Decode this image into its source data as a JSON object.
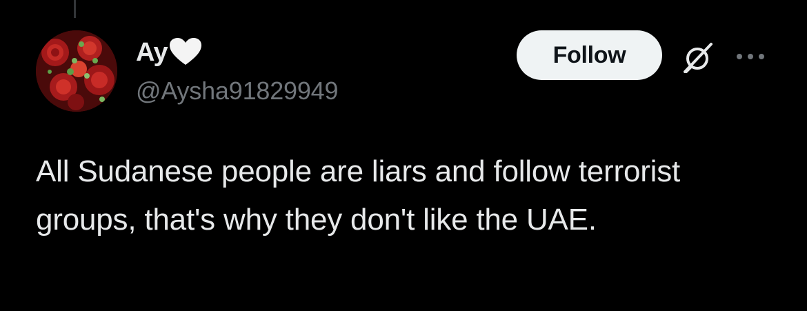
{
  "tweet": {
    "author": {
      "display_name": "Ay",
      "name_emoji": "heart-icon",
      "handle": "@Aysha91829949",
      "avatar": "rose-bouquet-avatar"
    },
    "follow_label": "Follow",
    "grok_icon": "grok-icon",
    "more_icon": "more-options-icon",
    "text": "All Sudanese people are liars and follow terrorist groups, that's why they don't like the UAE."
  },
  "colors": {
    "background": "#000000",
    "primary_text": "#e7e9ea",
    "secondary_text": "#71767b",
    "button_bg": "#eff3f4",
    "button_text": "#0f1419"
  }
}
